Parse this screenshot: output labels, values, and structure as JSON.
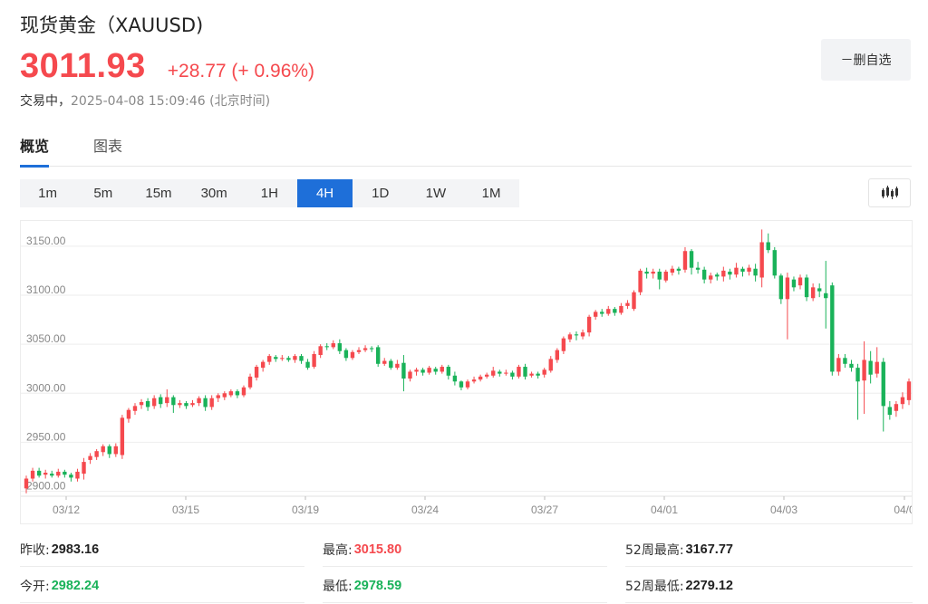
{
  "header": {
    "title": "现货黄金（XAUUSD)",
    "price": "3011.93",
    "change": "+28.77 (+ 0.96%)",
    "status": "交易中，",
    "timestamp": "2025-04-08 15:09:46 (北京时间)",
    "remove_label": "－删自选"
  },
  "tabs": [
    {
      "label": "概览",
      "active": true
    },
    {
      "label": "图表",
      "active": false
    }
  ],
  "intervals": [
    {
      "label": "1m",
      "active": false
    },
    {
      "label": "5m",
      "active": false
    },
    {
      "label": "15m",
      "active": false
    },
    {
      "label": "30m",
      "active": false
    },
    {
      "label": "1H",
      "active": false
    },
    {
      "label": "4H",
      "active": true
    },
    {
      "label": "1D",
      "active": false
    },
    {
      "label": "1W",
      "active": false
    },
    {
      "label": "1M",
      "active": false
    }
  ],
  "chart_type_icon": "candlestick-icon",
  "colors": {
    "up": "#f5494e",
    "down": "#19b259",
    "accent": "#1e6fd9"
  },
  "stats": {
    "prev_close": {
      "label": "昨收:",
      "value": "2983.16"
    },
    "open": {
      "label": "今开:",
      "value": "2982.24"
    },
    "high": {
      "label": "最高:",
      "value": "3015.80"
    },
    "low": {
      "label": "最低:",
      "value": "2978.59"
    },
    "week52_high": {
      "label": "52周最高:",
      "value": "3167.77"
    },
    "week52_low": {
      "label": "52周最低:",
      "value": "2279.12"
    }
  },
  "chart_data": {
    "type": "candlestick",
    "yticks": [
      "3150.00",
      "3100.00",
      "3050.00",
      "3000.00",
      "2950.00",
      "2900.00"
    ],
    "ylim": [
      2895,
      3172
    ],
    "xticks": [
      "03/12",
      "03/15",
      "03/19",
      "03/24",
      "03/27",
      "04/01",
      "04/03",
      "04/0"
    ],
    "grid": true,
    "candles": [
      [
        2903,
        2913,
        2898,
        2916
      ],
      [
        2913,
        2921,
        2910,
        2924
      ],
      [
        2921,
        2916,
        2914,
        2924
      ],
      [
        2917,
        2919,
        2913,
        2922
      ],
      [
        2918,
        2916,
        2914,
        2921
      ],
      [
        2916,
        2920,
        2914,
        2923
      ],
      [
        2920,
        2917,
        2914,
        2922
      ],
      [
        2917,
        2914,
        2910,
        2919
      ],
      [
        2913,
        2920,
        2910,
        2923
      ],
      [
        2918,
        2930,
        2912,
        2934
      ],
      [
        2932,
        2936,
        2928,
        2939
      ],
      [
        2935,
        2941,
        2932,
        2943
      ],
      [
        2940,
        2946,
        2936,
        2948
      ],
      [
        2946,
        2938,
        2934,
        2948
      ],
      [
        2938,
        2946,
        2935,
        2949
      ],
      [
        2937,
        2975,
        2933,
        2978
      ],
      [
        2974,
        2983,
        2970,
        2985
      ],
      [
        2982,
        2987,
        2978,
        2990
      ],
      [
        2988,
        2991,
        2984,
        2994
      ],
      [
        2992,
        2986,
        2982,
        2995
      ],
      [
        2987,
        2995,
        2984,
        2998
      ],
      [
        2996,
        2989,
        2985,
        2999
      ],
      [
        2990,
        2996,
        2986,
        3004
      ],
      [
        2996,
        2988,
        2980,
        2998
      ],
      [
        2988,
        2990,
        2985,
        2993
      ],
      [
        2990,
        2987,
        2984,
        2992
      ],
      [
        2988,
        2990,
        2986,
        2993
      ],
      [
        2990,
        2995,
        2987,
        2997
      ],
      [
        2995,
        2986,
        2982,
        2998
      ],
      [
        2986,
        2995,
        2983,
        2998
      ],
      [
        2995,
        2998,
        2991,
        3000
      ],
      [
        2996,
        3000,
        2993,
        3002
      ],
      [
        2998,
        3002,
        2996,
        3004
      ],
      [
        3002,
        2998,
        2995,
        3004
      ],
      [
        2998,
        3006,
        2996,
        3008
      ],
      [
        3006,
        3017,
        3004,
        3020
      ],
      [
        3016,
        3027,
        3013,
        3029
      ],
      [
        3026,
        3032,
        3022,
        3034
      ],
      [
        3032,
        3038,
        3029,
        3040
      ],
      [
        3037,
        3035,
        3032,
        3039
      ],
      [
        3035,
        3036,
        3033,
        3039
      ],
      [
        3036,
        3034,
        3032,
        3038
      ],
      [
        3034,
        3038,
        3031,
        3040
      ],
      [
        3038,
        3033,
        3030,
        3040
      ],
      [
        3032,
        3026,
        3024,
        3035
      ],
      [
        3027,
        3040,
        3025,
        3043
      ],
      [
        3039,
        3048,
        3036,
        3050
      ],
      [
        3048,
        3047,
        3044,
        3051
      ],
      [
        3047,
        3051,
        3045,
        3054
      ],
      [
        3051,
        3043,
        3040,
        3055
      ],
      [
        3044,
        3036,
        3033,
        3046
      ],
      [
        3036,
        3042,
        3034,
        3044
      ],
      [
        3042,
        3044,
        3040,
        3047
      ],
      [
        3044,
        3046,
        3042,
        3049
      ],
      [
        3046,
        3045,
        3042,
        3048
      ],
      [
        3047,
        3030,
        3027,
        3049
      ],
      [
        3030,
        3033,
        3028,
        3036
      ],
      [
        3033,
        3026,
        3024,
        3035
      ],
      [
        3026,
        3030,
        3024,
        3034
      ],
      [
        3031,
        3015,
        3002,
        3039
      ],
      [
        3015,
        3022,
        3012,
        3024
      ],
      [
        3022,
        3024,
        3018,
        3026
      ],
      [
        3024,
        3021,
        3018,
        3026
      ],
      [
        3021,
        3026,
        3019,
        3028
      ],
      [
        3025,
        3022,
        3019,
        3027
      ],
      [
        3022,
        3027,
        3020,
        3029
      ],
      [
        3027,
        3018,
        3014,
        3029
      ],
      [
        3018,
        3012,
        3008,
        3022
      ],
      [
        3012,
        3006,
        3003,
        3013
      ],
      [
        3006,
        3012,
        3004,
        3014
      ],
      [
        3012,
        3014,
        3010,
        3017
      ],
      [
        3014,
        3017,
        3012,
        3019
      ],
      [
        3017,
        3019,
        3015,
        3021
      ],
      [
        3018,
        3023,
        3016,
        3027
      ],
      [
        3022,
        3020,
        3017,
        3024
      ],
      [
        3020,
        3021,
        3018,
        3024
      ],
      [
        3021,
        3017,
        3014,
        3023
      ],
      [
        3017,
        3027,
        3015,
        3029
      ],
      [
        3027,
        3017,
        3014,
        3030
      ],
      [
        3018,
        3020,
        3016,
        3022
      ],
      [
        3020,
        3018,
        3015,
        3022
      ],
      [
        3019,
        3024,
        3016,
        3026
      ],
      [
        3023,
        3035,
        3021,
        3038
      ],
      [
        3034,
        3044,
        3031,
        3046
      ],
      [
        3043,
        3056,
        3040,
        3058
      ],
      [
        3055,
        3060,
        3052,
        3062
      ],
      [
        3060,
        3059,
        3054,
        3063
      ],
      [
        3058,
        3062,
        3055,
        3065
      ],
      [
        3062,
        3078,
        3058,
        3080
      ],
      [
        3078,
        3083,
        3075,
        3085
      ],
      [
        3083,
        3081,
        3078,
        3086
      ],
      [
        3081,
        3086,
        3079,
        3089
      ],
      [
        3086,
        3082,
        3079,
        3088
      ],
      [
        3082,
        3089,
        3080,
        3092
      ],
      [
        3089,
        3092,
        3086,
        3095
      ],
      [
        3086,
        3103,
        3084,
        3105
      ],
      [
        3103,
        3125,
        3100,
        3127
      ],
      [
        3124,
        3122,
        3117,
        3128
      ],
      [
        3122,
        3124,
        3117,
        3127
      ],
      [
        3124,
        3116,
        3106,
        3127
      ],
      [
        3115,
        3124,
        3113,
        3126
      ],
      [
        3123,
        3127,
        3120,
        3130
      ],
      [
        3127,
        3125,
        3121,
        3129
      ],
      [
        3126,
        3145,
        3123,
        3149
      ],
      [
        3145,
        3128,
        3121,
        3147
      ],
      [
        3128,
        3126,
        3122,
        3134
      ],
      [
        3126,
        3116,
        3112,
        3129
      ],
      [
        3116,
        3120,
        3112,
        3123
      ],
      [
        3121,
        3119,
        3115,
        3123
      ],
      [
        3119,
        3125,
        3114,
        3129
      ],
      [
        3124,
        3121,
        3116,
        3127
      ],
      [
        3121,
        3128,
        3118,
        3133
      ],
      [
        3127,
        3124,
        3119,
        3129
      ],
      [
        3124,
        3128,
        3120,
        3131
      ],
      [
        3127,
        3120,
        3114,
        3132
      ],
      [
        3118,
        3154,
        3108,
        3167
      ],
      [
        3154,
        3146,
        3143,
        3163
      ],
      [
        3146,
        3120,
        3117,
        3149
      ],
      [
        3120,
        3096,
        3091,
        3122
      ],
      [
        3096,
        3118,
        3055,
        3123
      ],
      [
        3116,
        3108,
        3104,
        3119
      ],
      [
        3110,
        3118,
        3106,
        3121
      ],
      [
        3118,
        3098,
        3094,
        3121
      ],
      [
        3097,
        3108,
        3094,
        3112
      ],
      [
        3107,
        3104,
        3098,
        3112
      ],
      [
        3102,
        3097,
        3066,
        3135
      ],
      [
        3110,
        3022,
        3018,
        3113
      ],
      [
        3022,
        3036,
        3018,
        3040
      ],
      [
        3036,
        3030,
        3026,
        3040
      ],
      [
        3030,
        3026,
        3022,
        3034
      ],
      [
        3026,
        3012,
        2973,
        3030
      ],
      [
        3013,
        3034,
        2979,
        3053
      ],
      [
        3033,
        3019,
        3010,
        3043
      ],
      [
        3020,
        3032,
        3016,
        3047
      ],
      [
        3032,
        2987,
        2961,
        3036
      ],
      [
        2986,
        2978,
        2973,
        2992
      ],
      [
        2982,
        2989,
        2976,
        2992
      ],
      [
        2989,
        2996,
        2984,
        3001
      ],
      [
        2993,
        3012,
        2988,
        3015
      ]
    ]
  }
}
